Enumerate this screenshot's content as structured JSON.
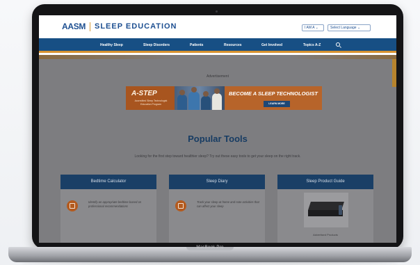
{
  "device": {
    "label": "MacBook Pro"
  },
  "site": {
    "logo": "AASM",
    "logo_subtitle": "SLEEP EDUCATION",
    "i_am_select": "I AM A",
    "language_select": "Select Language"
  },
  "nav": {
    "items": [
      "Healthy Sleep",
      "Sleep Disorders",
      "Patients",
      "Resources",
      "Get Involved",
      "Topics A-Z"
    ]
  },
  "ad": {
    "label": "Advertisement",
    "brand": "A-STEP",
    "brand_sub": "Accredited Sleep Technologist Education Program",
    "headline": "BECOME A SLEEP TECHNOLOGIST",
    "button": "LEARN MORE"
  },
  "popular": {
    "title": "Popular Tools",
    "description": "Looking for the first step toward healthier sleep? Try out these easy tools to get your sleep on the right track.",
    "cards": [
      {
        "title": "Bedtime Calculator",
        "text": "Identify an appropriate bedtime based on professional recommendations",
        "icon": "calculator-icon"
      },
      {
        "title": "Sleep Diary",
        "text": "Track your sleep at home and note activities that can affect your sleep",
        "icon": "book-icon"
      },
      {
        "title": "Sleep Product Guide",
        "footer": "Advertised Products"
      }
    ]
  },
  "colors": {
    "brand_blue": "#1d4f91",
    "nav_blue": "#174f84",
    "accent_orange": "#d7922f",
    "card_header": "#1a3f66"
  }
}
